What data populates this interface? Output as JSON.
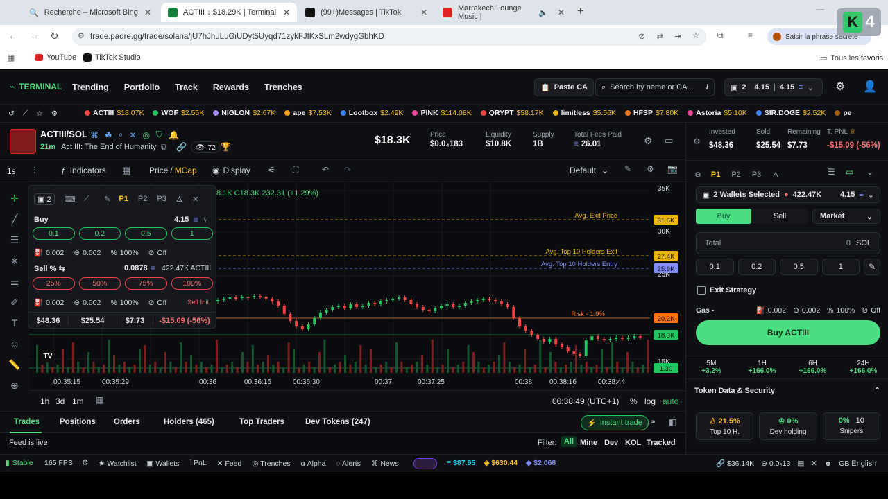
{
  "browser": {
    "tabs": [
      {
        "label": "Recherche – Microsoft Bing",
        "color": "#2b6cb0"
      },
      {
        "label": "ACTIII ↓ $18.29K | Terminal",
        "color": "#15803d"
      },
      {
        "label": "(99+)Messages | TikTok",
        "color": "#111"
      },
      {
        "label": "Marrakech Lounge Music |",
        "color": "#dc2626"
      }
    ],
    "url": "trade.padre.gg/trade/solana/jU7hJhuLuGiUDyt5Uyqd71zykFJfKxSLm2wdygGbhKD",
    "secret_btn": "Saisir la phrase secrète",
    "bookmarks": [
      "YouTube",
      "TikTok Studio"
    ],
    "all_favs": "Tous les favoris",
    "badge": "4"
  },
  "nav": {
    "brand": "TERMINAL",
    "links": [
      "Trending",
      "Portfolio",
      "Track",
      "Rewards",
      "Trenches"
    ],
    "paste": "Paste CA",
    "search": "Search by name or CA...",
    "slash": "/",
    "wallet_count": "2",
    "bal1": "4.15",
    "bal2": "4.15"
  },
  "ticker": [
    {
      "n": "ACTIII",
      "v": "$18.07K",
      "c": "#ef4444"
    },
    {
      "n": "WOF",
      "v": "$2.55K",
      "c": "#22c55e"
    },
    {
      "n": "NIGLON",
      "v": "$2.67K",
      "c": "#a78bfa"
    },
    {
      "n": "ape",
      "v": "$7.53K",
      "c": "#f59e0b"
    },
    {
      "n": "Lootbox",
      "v": "$2.49K",
      "c": "#3b82f6"
    },
    {
      "n": "PINK",
      "v": "$114.08K",
      "c": "#ec4899"
    },
    {
      "n": "QRYPT",
      "v": "$58.17K",
      "c": "#ef4444"
    },
    {
      "n": "limitless",
      "v": "$5.56K",
      "c": "#eab308"
    },
    {
      "n": "HFSP",
      "v": "$7.80K",
      "c": "#f97316"
    },
    {
      "n": "Astoria",
      "v": "$5.10K",
      "c": "#ec4899"
    },
    {
      "n": "SIR.DOGE",
      "v": "$2.52K",
      "c": "#3b82f6"
    },
    {
      "n": "pe",
      "v": "",
      "c": "#a16207"
    }
  ],
  "token": {
    "pair": "ACTIII/SOL",
    "age": "21m",
    "name": "Act III: The End of Humanity",
    "holders_icon_count": "72",
    "mcap": "$18.3K",
    "stats": [
      {
        "l": "Price",
        "v": "$0.0₄183"
      },
      {
        "l": "Liquidity",
        "v": "$10.8K"
      },
      {
        "l": "Supply",
        "v": "1B"
      },
      {
        "l": "Total Fees Paid",
        "v": "26.01"
      }
    ]
  },
  "charttool": {
    "interval": "1s",
    "indicators": "Indicators",
    "price": "Price",
    "mcap": "MCap",
    "display": "Display",
    "default": "Default"
  },
  "chart": {
    "ohlc": "8.1K C18.3K 232.31 (+1.29%)",
    "yticks": [
      "35K",
      "30K",
      "25K",
      "15K"
    ],
    "lines": [
      {
        "label": "Avg. Exit Price",
        "tag": "31.6K",
        "color": "#eab308"
      },
      {
        "label": "Avg. Top 10 Holders Exit",
        "tag": "27.4K",
        "color": "#eab308"
      },
      {
        "label": "Avg. Top 10 Holders Entry",
        "tag": "25.9K",
        "color": "#818cf8"
      },
      {
        "label": "Risk - 1.9%",
        "tag": "20.2K",
        "color": "#f97316"
      },
      {
        "label": "",
        "tag": "18.3K",
        "color": "#22c55e"
      },
      {
        "label": "",
        "tag": "1.30",
        "color": "#22c55e"
      }
    ],
    "xticks": [
      "00:35:15",
      "00:35:29",
      "00:36",
      "00:36:16",
      "00:36:30",
      "00:37",
      "00:37:25",
      "00:38",
      "00:38:16",
      "00:38:44"
    ],
    "tv": "TV"
  },
  "quick": {
    "count": "2",
    "presets": [
      "P1",
      "P2",
      "P3"
    ],
    "buy": "Buy",
    "buy_bal": "4.15",
    "buy_amts": [
      "0.1",
      "0.2",
      "0.5",
      "1"
    ],
    "cfg": [
      "0.002",
      "0.002",
      "100%",
      "Off"
    ],
    "sell": "Sell % ⇆",
    "sell_sol": "0.0878",
    "sell_tok": "422.47K ACTIII",
    "sell_amts": [
      "25%",
      "50%",
      "75%",
      "100%"
    ],
    "cfg2": [
      "0.002",
      "0.002",
      "100%",
      "Off"
    ],
    "sell_init": "Sell Init.",
    "pnl": [
      "$48.36",
      "$25.54",
      "$7.73",
      "-$15.09 (-56%)"
    ]
  },
  "timebar": {
    "ranges": [
      "1h",
      "3d",
      "1m"
    ],
    "clock": "00:38:49 (UTC+1)",
    "pct": "%",
    "log": "log",
    "auto": "auto"
  },
  "tabs2": {
    "items": [
      "Trades",
      "Positions",
      "Orders",
      "Holders (465)",
      "Top Traders",
      "Dev Tokens (247)"
    ],
    "instant": "Instant trade"
  },
  "feed": {
    "live": "Feed is live",
    "filter": "Filter:",
    "opts": [
      "All",
      "Mine",
      "Dev",
      "KOL",
      "Tracked"
    ]
  },
  "right": {
    "summary": [
      {
        "l": "Invested",
        "v": "$48.36"
      },
      {
        "l": "Sold",
        "v": "$25.54"
      },
      {
        "l": "Remaining",
        "v": "$7.73"
      },
      {
        "l": "T. PNL",
        "v": "-$15.09 (-56%)"
      }
    ],
    "presets": [
      "P1",
      "P2",
      "P3"
    ],
    "wallets": "2 Wallets Selected",
    "wallet_tok": "422.47K",
    "wallet_bal": "4.15",
    "buy": "Buy",
    "sell": "Sell",
    "market": "Market",
    "total": "Total",
    "total_val": "0",
    "sol": "SOL",
    "amts": [
      "0.1",
      "0.2",
      "0.5",
      "1"
    ],
    "exit": "Exit Strategy",
    "gas": "Gas -",
    "gas_vals": [
      "0.002",
      "0.002",
      "100%",
      "Off"
    ],
    "buy_btn": "Buy ACTIII",
    "changes": [
      {
        "t": "5M",
        "v": "+3.2%"
      },
      {
        "t": "1H",
        "v": "+166.0%"
      },
      {
        "t": "6H",
        "v": "+166.0%"
      },
      {
        "t": "24H",
        "v": "+166.0%"
      }
    ],
    "security": "Token Data & Security",
    "sec": [
      {
        "v": "21.5%",
        "l": "Top 10 H."
      },
      {
        "v": "0%",
        "l": "Dev holding"
      },
      {
        "v": "0%",
        "v2": "10",
        "l": "Snipers"
      }
    ]
  },
  "status": {
    "stable": "Stable",
    "fps": "165 FPS",
    "items": [
      "Watchlist",
      "Wallets",
      "PnL",
      "Feed",
      "Trenches",
      "Alpha",
      "Alerts",
      "News"
    ],
    "sol": "$87.95",
    "bnb": "$630.44",
    "eth": "$2,068",
    "vol": "$36.14K",
    "fee": "0.0₅13",
    "lang": "English"
  }
}
